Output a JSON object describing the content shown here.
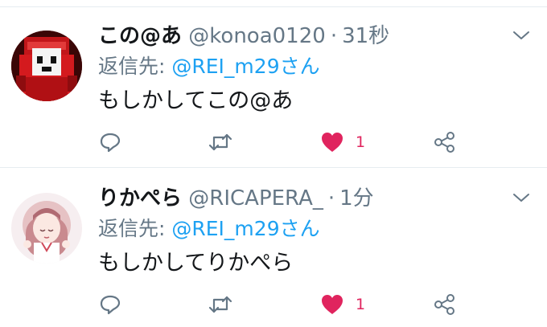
{
  "colors": {
    "text": "#14171a",
    "secondary": "#657786",
    "accent_blue": "#1da1f2",
    "like_red": "#e0245e",
    "divider": "#e6ecf0"
  },
  "tweets": [
    {
      "display_name": "この@あ",
      "handle": "@konoa0120",
      "separator": "·",
      "time": "31秒",
      "reply_label": "返信先:",
      "reply_to": "@REI_m29さん",
      "text": "もしかしてこの@あ",
      "like_count": "1",
      "liked": true,
      "icons": [
        "reply-icon",
        "retweet-icon",
        "heart-icon",
        "share-icon",
        "chevron-down-icon"
      ]
    },
    {
      "display_name": "りかぺら",
      "handle": "@RICAPERA_",
      "separator": "·",
      "time": "1分",
      "reply_label": "返信先:",
      "reply_to": "@REI_m29さん",
      "text": "もしかしてりかぺら",
      "like_count": "1",
      "liked": true,
      "icons": [
        "reply-icon",
        "retweet-icon",
        "heart-icon",
        "share-icon",
        "chevron-down-icon"
      ]
    }
  ]
}
